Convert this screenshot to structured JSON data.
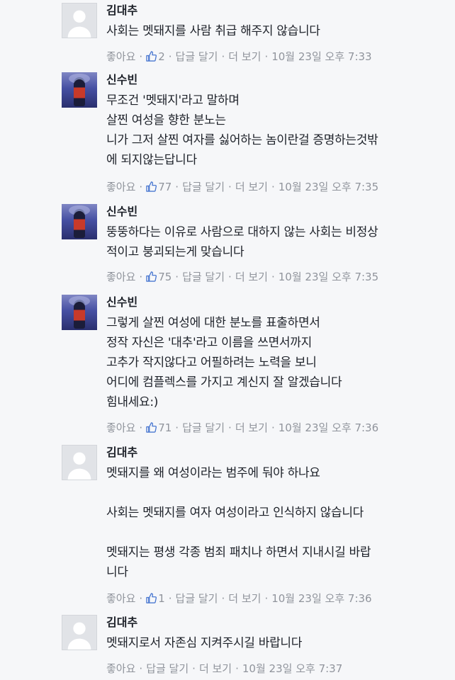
{
  "labels": {
    "like": "좋아요",
    "reply": "답글 달기",
    "more": "더 보기"
  },
  "colors": {
    "background": "#f6f7f9",
    "text": "#1d2129",
    "meta": "#90949c",
    "default_avatar": "#e1e3e7"
  },
  "comments": [
    {
      "author": "김대추",
      "avatar": "default-profile-silhouette",
      "lines": [
        "사회는 멧돼지를 사람 취급 해주지 않습니다"
      ],
      "likes": "2",
      "time": "10월 23일 오후 7:33"
    },
    {
      "author": "신수빈",
      "avatar": "profile-photo",
      "lines": [
        "무조건 '멧돼지'라고 말하며",
        "살찐 여성을 향한 분노는",
        "니가 그저 살찐 여자를 싫어하는 놈이란걸 증명하는것밖",
        "에 되지않는답니다"
      ],
      "likes": "77",
      "time": "10월 23일 오후 7:35"
    },
    {
      "author": "신수빈",
      "avatar": "profile-photo",
      "lines": [
        "뚱뚱하다는 이유로 사람으로 대하지 않는 사회는 비정상",
        "적이고 붕괴되는게 맞습니다"
      ],
      "likes": "75",
      "time": "10월 23일 오후 7:35"
    },
    {
      "author": "신수빈",
      "avatar": "profile-photo",
      "lines": [
        "그렇게 살찐 여성에 대한 분노를 표출하면서",
        "정작 자신은 '대추'라고 이름을 쓰면서까지",
        "고추가 작지않다고 어필하려는 노력을 보니",
        "어디에 컴플렉스를 가지고 계신지 잘 알겠습니다",
        "힘내세요:)"
      ],
      "likes": "71",
      "time": "10월 23일 오후 7:36"
    },
    {
      "author": "김대추",
      "avatar": "default-profile-silhouette",
      "lines": [
        "멧돼지를 왜 여성이라는 범주에 둬야 하나요",
        "",
        "사회는 멧돼지를 여자 여성이라고 인식하지 않습니다",
        "",
        "멧돼지는 평생 각종 범죄 패치나 하면서 지내시길 바랍",
        "니다"
      ],
      "likes": "1",
      "time": "10월 23일 오후 7:36"
    },
    {
      "author": "김대추",
      "avatar": "default-profile-silhouette",
      "lines": [
        "멧돼지로서 자존심 지켜주시길 바랍니다"
      ],
      "likes": "",
      "time": "10월 23일 오후 7:37"
    }
  ]
}
